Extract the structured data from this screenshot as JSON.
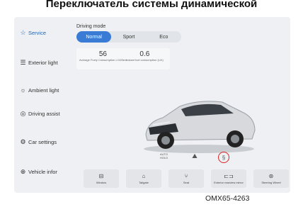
{
  "header": {
    "title": "Переключатель системы динамической"
  },
  "sidebar": {
    "items": [
      {
        "label": "Service",
        "icon": "star-icon",
        "active": true
      },
      {
        "label": "Exterior light",
        "icon": "headlight-icon",
        "active": false
      },
      {
        "label": "Ambient light",
        "icon": "sun-icon",
        "active": false
      },
      {
        "label": "Driving assist",
        "icon": "steering-icon",
        "active": false
      },
      {
        "label": "Car settings",
        "icon": "gear-icon",
        "active": false
      },
      {
        "label": "Vehicle infor",
        "icon": "info-icon",
        "active": false
      }
    ]
  },
  "driving_mode": {
    "label": "Driving mode",
    "options": [
      "Normal",
      "Sport",
      "Eco"
    ],
    "selected": "Normal"
  },
  "stats": {
    "consumption_value": "56",
    "consumption_label": "Average Fuely Consumption",
    "consumption_unit": "L/100km",
    "instant_value": "0.6",
    "instant_label": "Instant fuel consumption",
    "instant_unit": "(L/h)"
  },
  "quick_icons": {
    "auto_hold_label": "AUTO HOLD"
  },
  "bottom_buttons": [
    {
      "label": "Window",
      "icon": "window-icon"
    },
    {
      "label": "Tailgate",
      "icon": "tailgate-icon"
    },
    {
      "label": "Seat",
      "icon": "seat-icon"
    },
    {
      "label": "Exterior rearview mirror",
      "icon": "mirror-icon"
    },
    {
      "label": "Steering Wheel",
      "icon": "steering-wheel-icon"
    }
  ],
  "footer": {
    "code": "OMX65-4263"
  },
  "colors": {
    "accent": "#3a7bd5",
    "highlight": "#d22222",
    "background": "#eef0f3"
  }
}
